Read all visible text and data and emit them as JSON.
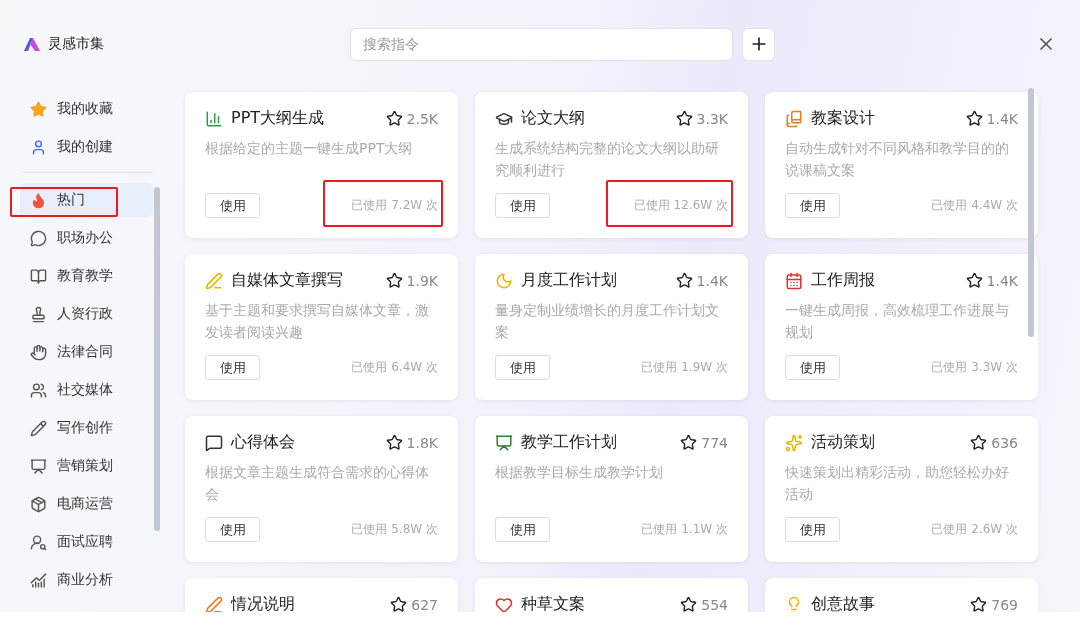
{
  "app_title": "灵感市集",
  "search": {
    "placeholder": "搜索指令"
  },
  "personal": [
    {
      "label": "我的收藏"
    },
    {
      "label": "我的创建"
    }
  ],
  "categories": [
    {
      "label": "热门",
      "selected": true,
      "marked": true
    },
    {
      "label": "职场办公",
      "selected": false,
      "marked": false
    },
    {
      "label": "教育教学",
      "selected": false,
      "marked": false
    },
    {
      "label": "人资行政",
      "selected": false,
      "marked": false
    },
    {
      "label": "法律合同",
      "selected": false,
      "marked": false
    },
    {
      "label": "社交媒体",
      "selected": false,
      "marked": false
    },
    {
      "label": "写作创作",
      "selected": false,
      "marked": false
    },
    {
      "label": "营销策划",
      "selected": false,
      "marked": false
    },
    {
      "label": "电商运营",
      "selected": false,
      "marked": false
    },
    {
      "label": "面试应聘",
      "selected": false,
      "marked": false
    },
    {
      "label": "商业分析",
      "selected": false,
      "marked": false
    }
  ],
  "cards": [
    {
      "title": "PPT大纲生成",
      "favorites": "2.5K",
      "description": "根据给定的主题一键生成PPT大纲",
      "button": "使用",
      "usage": "已使用 7.2W 次",
      "usage_marked": true
    },
    {
      "title": "论文大纲",
      "favorites": "3.3K",
      "description": "生成系统结构完整的论文大纲以助研究顺利进行",
      "button": "使用",
      "usage": "已使用 12.6W 次",
      "usage_marked": true
    },
    {
      "title": "教案设计",
      "favorites": "1.4K",
      "description": "自动生成针对不同风格和教学目的的说课稿文案",
      "button": "使用",
      "usage": "已使用 4.4W 次",
      "usage_marked": false
    },
    {
      "title": "自媒体文章撰写",
      "favorites": "1.9K",
      "description": "基于主题和要求撰写自媒体文章，激发读者阅读兴趣",
      "button": "使用",
      "usage": "已使用 6.4W 次",
      "usage_marked": false
    },
    {
      "title": "月度工作计划",
      "favorites": "1.4K",
      "description": "量身定制业绩增长的月度工作计划文案",
      "button": "使用",
      "usage": "已使用 1.9W 次",
      "usage_marked": false
    },
    {
      "title": "工作周报",
      "favorites": "1.4K",
      "description": "一键生成周报，高效梳理工作进展与规划",
      "button": "使用",
      "usage": "已使用 3.3W 次",
      "usage_marked": false
    },
    {
      "title": "心得体会",
      "favorites": "1.8K",
      "description": "根据文章主题生成符合需求的心得体会",
      "button": "使用",
      "usage": "已使用 5.8W 次",
      "usage_marked": false
    },
    {
      "title": "教学工作计划",
      "favorites": "774",
      "description": "根据教学目标生成教学计划",
      "button": "使用",
      "usage": "已使用 1.1W 次",
      "usage_marked": false
    },
    {
      "title": "活动策划",
      "favorites": "636",
      "description": "快速策划出精彩活动，助您轻松办好活动",
      "button": "使用",
      "usage": "已使用 2.6W 次",
      "usage_marked": false
    },
    {
      "title": "情况说明",
      "favorites": "627"
    },
    {
      "title": "种草文案",
      "favorites": "554"
    },
    {
      "title": "创意故事",
      "favorites": "769"
    }
  ]
}
